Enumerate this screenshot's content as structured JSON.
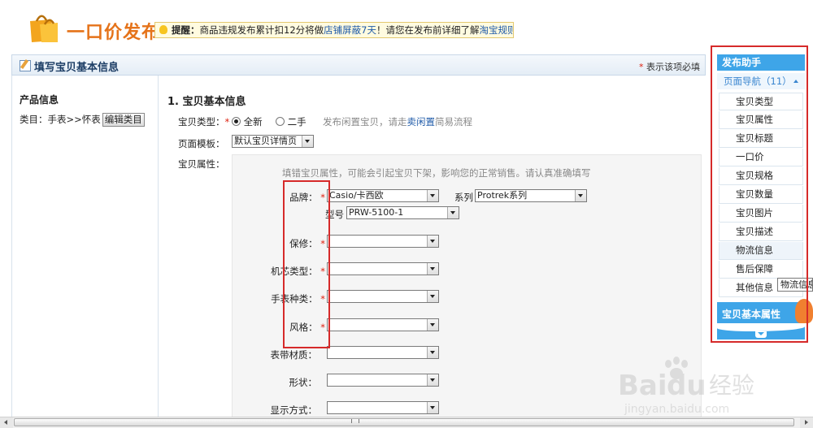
{
  "header": {
    "title": "一口价发布",
    "notice": {
      "prefix": "提醒：",
      "text1": "商品违规发布累计扣12分将做",
      "link1": "店铺屏蔽7天",
      "text2": "！请您在发布前详细了解",
      "link2": "淘宝规则",
      "text3": "。"
    }
  },
  "section": {
    "title": "填写宝贝基本信息",
    "required_mark": "*",
    "required_note": "表示该项必填"
  },
  "left": {
    "heading": "产品信息",
    "category_prefix": "类目：",
    "category": "手表>>怀表",
    "edit_button": "编辑类目"
  },
  "main": {
    "title": "1. 宝贝基本信息",
    "type_label": "宝贝类型：",
    "type_options": [
      "全新",
      "二手"
    ],
    "type_hint_pre": "发布闲置宝贝，请走",
    "type_hint_link": "卖闲置",
    "type_hint_post": "简易流程",
    "template_label": "页面模板：",
    "template_value": "默认宝贝详情页",
    "attr_label": "宝贝属性：",
    "attr_hint": "填错宝贝属性，可能会引起宝贝下架，影响您的正常销售。请认真准确填写",
    "fields": {
      "brand": {
        "label": "品牌：",
        "value": "Casio/卡西欧"
      },
      "series": {
        "label": "系列",
        "value": "Protrek系列"
      },
      "model": {
        "label": "型号",
        "value": "PRW-5100-1"
      },
      "warranty": {
        "label": "保修："
      },
      "movement": {
        "label": "机芯类型："
      },
      "watch_type": {
        "label": "手表种类："
      },
      "style": {
        "label": "风格："
      },
      "strap": {
        "label": "表带材质："
      },
      "shape": {
        "label": "形状："
      },
      "display": {
        "label": "显示方式："
      }
    }
  },
  "sidebar": {
    "heading": "发布助手",
    "nav_label": "页面导航（11）",
    "items": [
      "宝贝类型",
      "宝贝属性",
      "宝贝标题",
      "一口价",
      "宝贝规格",
      "宝贝数量",
      "宝贝图片",
      "宝贝描述",
      "物流信息",
      "售后保障",
      "其他信息"
    ],
    "bottom_label": "宝贝基本属性",
    "tooltip": "物流信息"
  },
  "watermark": {
    "brand": "Baidu经验",
    "url": "jingyan.baidu.com"
  },
  "colors": {
    "accent_orange": "#e5731a",
    "sidebar_blue": "#3ea5e8",
    "annotation_red": "#d62a2a",
    "link_blue": "#1e5aa8"
  }
}
